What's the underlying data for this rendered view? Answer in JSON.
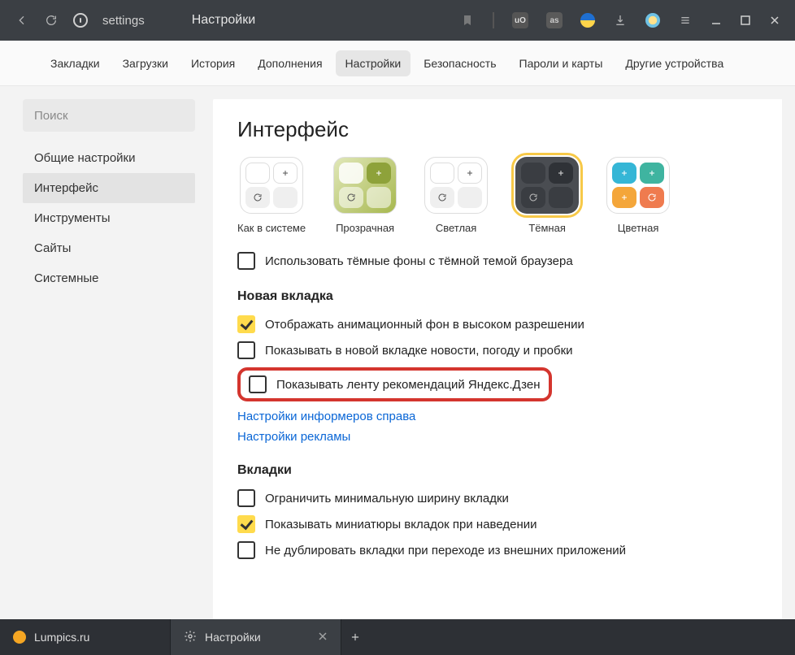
{
  "titlebar": {
    "address_text": "settings",
    "page_title": "Настройки"
  },
  "nav_tabs": {
    "items": [
      "Закладки",
      "Загрузки",
      "История",
      "Дополнения",
      "Настройки",
      "Безопасность",
      "Пароли и карты",
      "Другие устройства"
    ],
    "active_index": 4
  },
  "sidebar": {
    "search_placeholder": "Поиск",
    "items": [
      "Общие настройки",
      "Интерфейс",
      "Инструменты",
      "Сайты",
      "Системные"
    ],
    "active_index": 1
  },
  "content": {
    "heading": "Интерфейс",
    "themes": [
      {
        "label": "Как в системе"
      },
      {
        "label": "Прозрачная"
      },
      {
        "label": "Светлая"
      },
      {
        "label": "Тёмная",
        "selected": true
      },
      {
        "label": "Цветная"
      }
    ],
    "dark_bg_opt": {
      "label": "Использовать тёмные фоны с тёмной темой браузера",
      "checked": false
    },
    "section_newtab": "Новая вкладка",
    "newtab_opts": [
      {
        "label": "Отображать анимационный фон в высоком разрешении",
        "checked": true
      },
      {
        "label": "Показывать в новой вкладке новости, погоду и пробки",
        "checked": false
      },
      {
        "label": "Показывать ленту рекомендаций Яндекс.Дзен",
        "checked": false,
        "highlighted": true
      }
    ],
    "links": [
      "Настройки информеров справа",
      "Настройки рекламы"
    ],
    "section_tabs": "Вкладки",
    "tabs_opts": [
      {
        "label": "Ограничить минимальную ширину вкладки",
        "checked": false
      },
      {
        "label": "Показывать миниатюры вкладок при наведении",
        "checked": true
      },
      {
        "label": "Не дублировать вкладки при переходе из внешних приложений",
        "checked": false
      }
    ]
  },
  "tabbar": {
    "tabs": [
      {
        "title": "Lumpics.ru",
        "fav_color": "#f5a623"
      },
      {
        "title": "Настройки",
        "fav_icon": "gear",
        "active": true
      }
    ]
  }
}
